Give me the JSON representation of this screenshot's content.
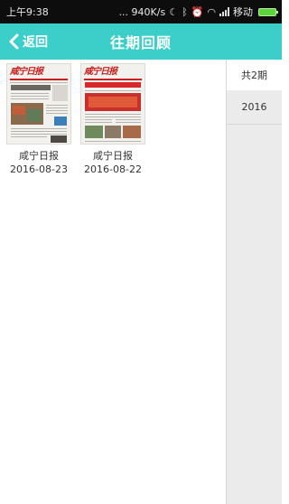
{
  "status_bar": {
    "time": "上午9:38",
    "speed": "... 940K/s",
    "carrier": "移动",
    "icons": [
      "moon-icon",
      "bluetooth-icon",
      "alarm-icon",
      "wifi-icon",
      "signal-icon",
      "battery-icon"
    ]
  },
  "header": {
    "back_label": "返回",
    "title": "往期回顾",
    "accent_color": "#3ccfc9"
  },
  "issues": [
    {
      "name": "咸宁日报",
      "date": "2016-08-23",
      "masthead": "咸宁日报"
    },
    {
      "name": "咸宁日报",
      "date": "2016-08-22",
      "masthead": "咸宁日报"
    }
  ],
  "year_panel": {
    "count_label": "共2期",
    "years": [
      "2016"
    ]
  }
}
